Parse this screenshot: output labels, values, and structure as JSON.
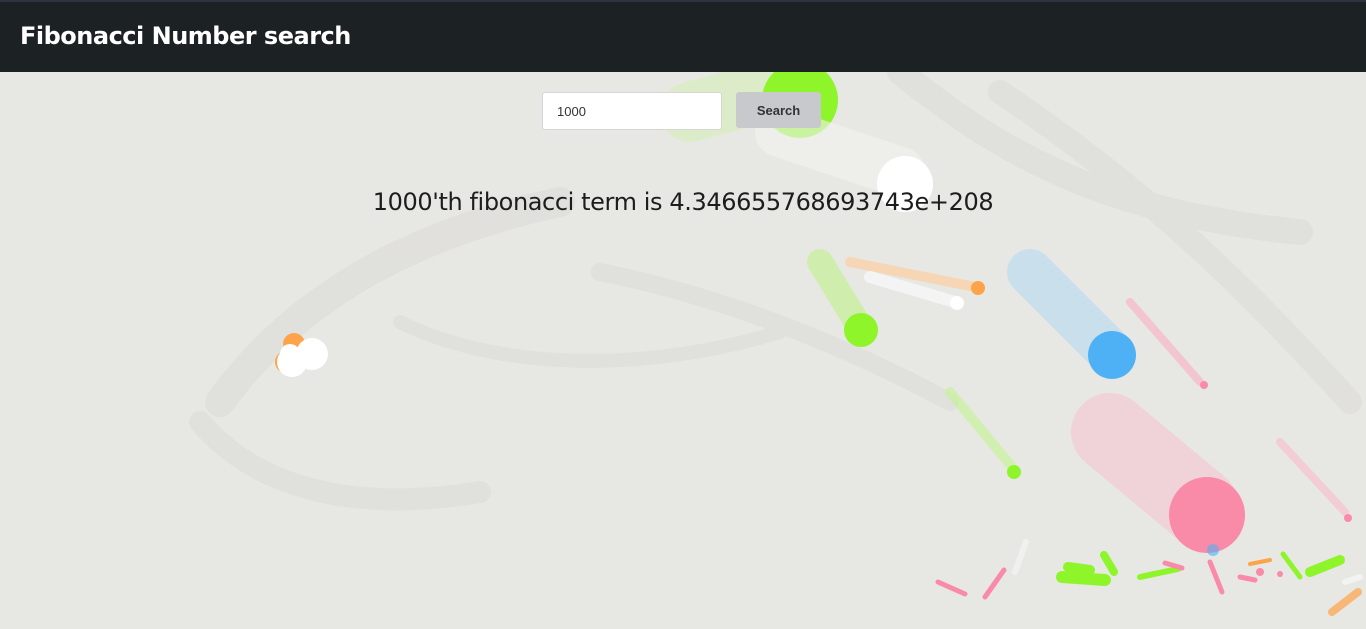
{
  "header": {
    "title": "Fibonacci Number search"
  },
  "search": {
    "value": "1000",
    "button_label": "Search"
  },
  "result": {
    "text": "1000'th fibonacci term is 4.346655768693743e+208"
  },
  "colors": {
    "header_bg": "#1c2123",
    "page_bg": "#e7e7e3",
    "green": "#8ef52a",
    "blue": "#4fb1f5",
    "pink": "#f98aa8",
    "orange": "#fda44a",
    "white": "#ffffff"
  }
}
